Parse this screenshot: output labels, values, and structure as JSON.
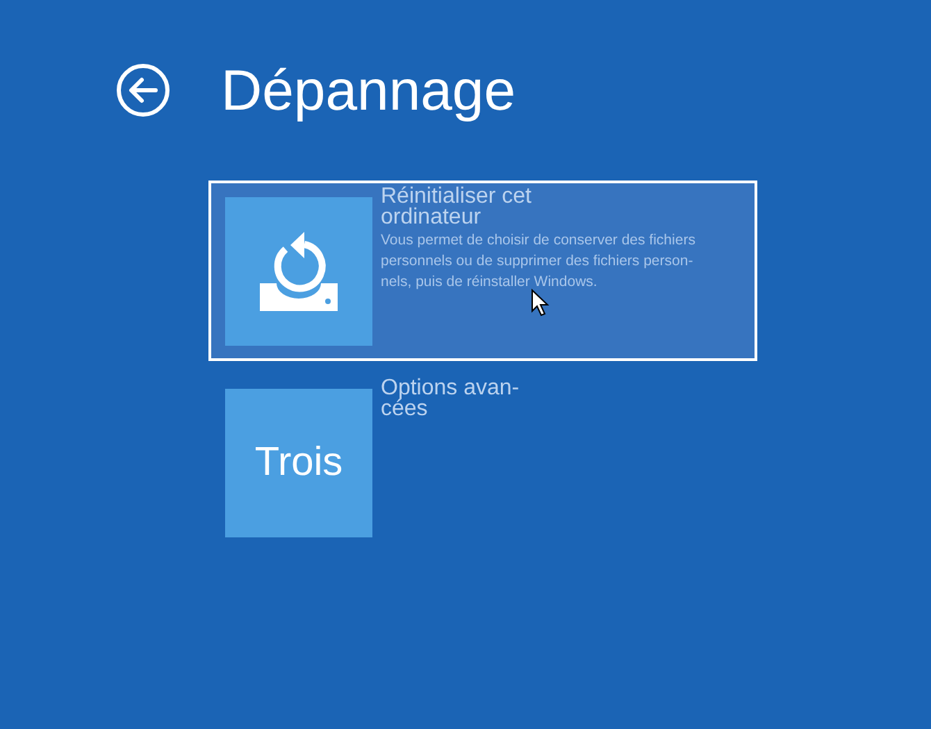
{
  "header": {
    "title": "Dépannage"
  },
  "options": [
    {
      "kind": "icon",
      "selected": true,
      "title": "Réinitialiser cet\nordinateur",
      "description": "Vous permet de choisir de conserver des fichiers\npersonnels ou de supprimer des fichiers person-\nnels, puis de réinstaller Windows."
    },
    {
      "kind": "text",
      "selected": false,
      "tile_text": "Trois",
      "title": "Options avan-\ncées"
    }
  ]
}
